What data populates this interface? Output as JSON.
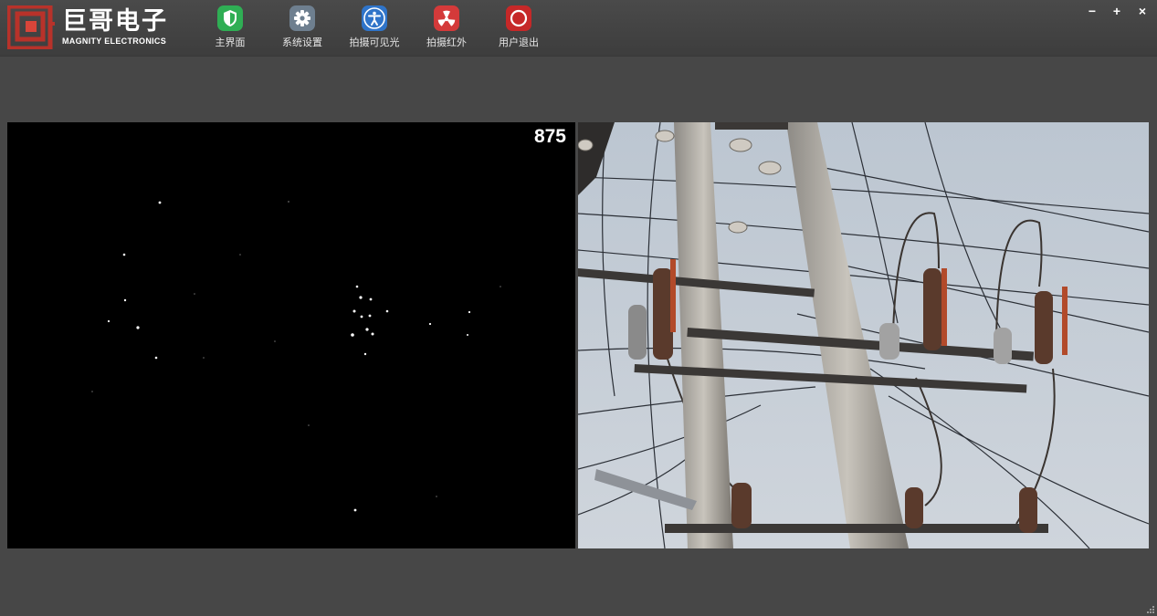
{
  "brand": {
    "name_cn": "巨哥电子",
    "name_en": "MAGNITY ELECTRONICS",
    "color": "#c0392b"
  },
  "toolbar": {
    "items": [
      {
        "label": "主界面",
        "icon": "shield-icon",
        "color": "#2fae54"
      },
      {
        "label": "系统设置",
        "icon": "gear-icon",
        "color": "#6e7f8f"
      },
      {
        "label": "拍摄可见光",
        "icon": "accessibility-icon",
        "color": "#2f74c9"
      },
      {
        "label": "拍摄红外",
        "icon": "radiation-icon",
        "color": "#d43a3a"
      },
      {
        "label": "用户退出",
        "icon": "power-circle-icon",
        "color": "#c62828"
      }
    ]
  },
  "window_controls": {
    "minimize": "−",
    "maximize": "+",
    "close": "×"
  },
  "infrared_view": {
    "frame_counter": "875"
  }
}
